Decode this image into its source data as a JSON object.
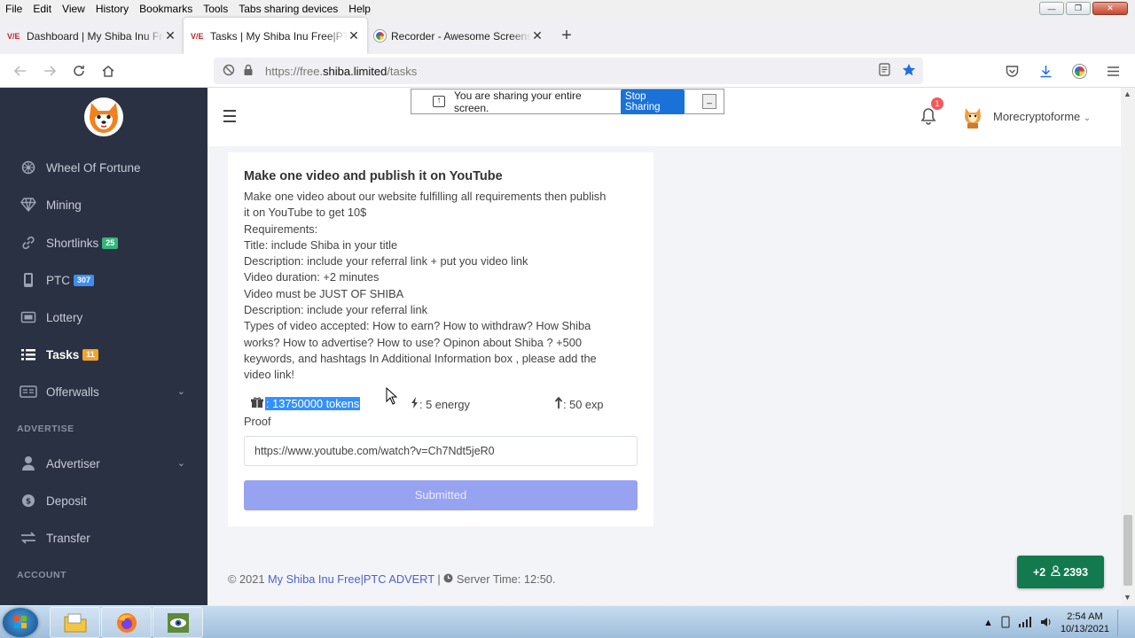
{
  "menubar": {
    "items": [
      "File",
      "Edit",
      "View",
      "History",
      "Bookmarks",
      "Tools",
      "Tabs sharing devices",
      "Help"
    ]
  },
  "tabs": [
    {
      "label": "Dashboard | My Shiba Inu Free|PTC",
      "favicon": "shiba-favicon"
    },
    {
      "label": "Tasks | My Shiba Inu Free|PTC A",
      "favicon": "shiba-favicon",
      "active": true
    },
    {
      "label": "Recorder - Awesome Screensho",
      "favicon": "recorder-favicon"
    }
  ],
  "urlbar": {
    "url_prefix": "https://free.",
    "url_domain": "shiba.limited",
    "url_path": "/tasks"
  },
  "share_bar": {
    "message": "You are sharing your entire screen.",
    "stop_label": "Stop Sharing"
  },
  "header": {
    "notification_count": "1",
    "username": "Morecryptoforme"
  },
  "sidebar": {
    "items": [
      {
        "label": "Wheel Of Fortune",
        "icon": "gear-icon"
      },
      {
        "label": "Mining",
        "icon": "diamond-icon"
      },
      {
        "label": "Shortlinks",
        "icon": "link-icon",
        "badge": "25",
        "badge_color": "#2fb87a"
      },
      {
        "label": "PTC",
        "icon": "mobile-icon",
        "badge": "307",
        "badge_color": "#3e8ef0"
      },
      {
        "label": "Lottery",
        "icon": "ticket-icon"
      },
      {
        "label": "Tasks",
        "icon": "list-icon",
        "badge": "11",
        "badge_color": "#f0a42e",
        "active": true
      },
      {
        "label": "Offerwalls",
        "icon": "window-icon"
      },
      {
        "label": "Advertiser",
        "icon": "user-icon"
      },
      {
        "label": "Deposit",
        "icon": "coin-icon"
      },
      {
        "label": "Transfer",
        "icon": "transfer-icon"
      }
    ],
    "sections": [
      "ADVERTISE",
      "ACCOUNT"
    ]
  },
  "task": {
    "title": "Make one video and publish it on YouTube",
    "description_lines": [
      "Make one video about our website fulfilling all requirements then publish",
      "it on YouTube to get 10$",
      "Requirements:",
      "Title: include Shiba in your title",
      "Description: include your referral link + put you video link",
      "Video duration: +2 minutes",
      "Video must be JUST OF SHIBA",
      "Description: include your referral link",
      "Types of video accepted: How to earn? How to withdraw? How Shiba",
      "works? How to advertise? How to use? Opinon about Shiba ? +500",
      "keywords, and hashtags In Additional Information box , please add the",
      "video link!"
    ],
    "reward_tokens": "13750000 tokens",
    "reward_energy": "5 energy",
    "reward_exp": "50 exp",
    "proof_label": "Proof",
    "proof_value": "https://www.youtube.com/watch?v=Ch7Ndt5jeR0",
    "submit_label": "Submitted"
  },
  "footer": {
    "prefix": "© 2021",
    "site_link": "My Shiba Inu Free|PTC ADVERT",
    "separator": "|",
    "server_time": "Server Time: 12:50."
  },
  "counter": {
    "delta": "+2",
    "online": "2393"
  },
  "taskbar": {
    "time": "2:54 AM",
    "date": "10/13/2021"
  },
  "colors": {
    "sidebar_bg": "#2a3142",
    "accent": "#5061c7",
    "submit_bg": "#97a3f0",
    "counter_bg": "#127a4e"
  }
}
